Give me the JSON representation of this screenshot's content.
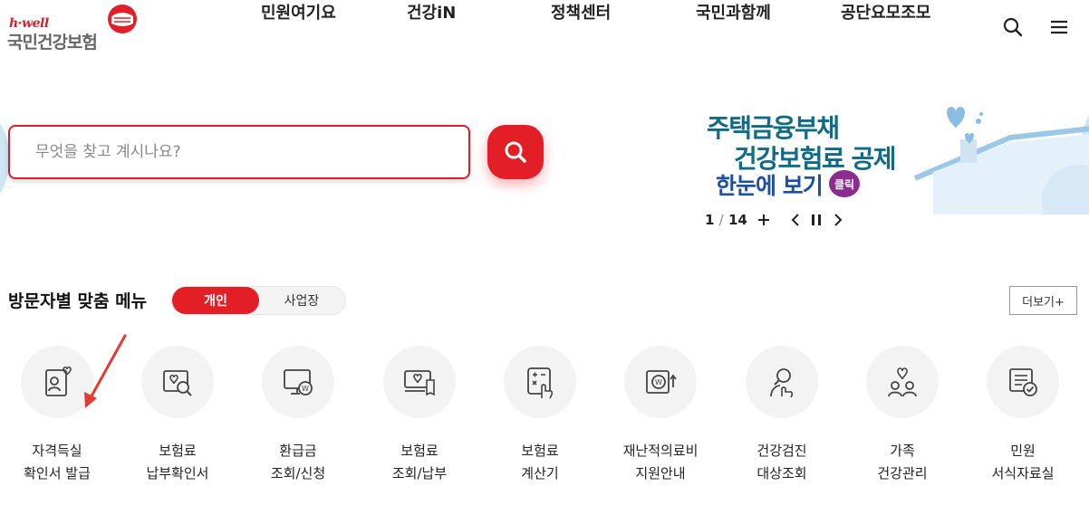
{
  "header": {
    "logo_small": "h·well",
    "logo_name": "국민건강보험",
    "nav": [
      "민원여기요",
      "건강iN",
      "정책센터",
      "국민과함께",
      "공단요모조모"
    ]
  },
  "search": {
    "placeholder": "무엇을 찾고 계시나요?",
    "value": ""
  },
  "banner": {
    "line1": "주택금융부채",
    "line2": "건강보험료 공제",
    "line3": "한눈에 보기",
    "click": "클릭",
    "current": "1",
    "separator": "/",
    "total": "14"
  },
  "section": {
    "title": "방문자별 맞춤 메뉴",
    "toggle_active": "개인",
    "toggle_inactive": "사업장",
    "more": "더보기+"
  },
  "menu": [
    {
      "label": "자격득실\n확인서 발급",
      "icon": "person-card-icon"
    },
    {
      "label": "보험료\n납부확인서",
      "icon": "heart-search-icon"
    },
    {
      "label": "환급금\n조회/신청",
      "icon": "monitor-won-icon"
    },
    {
      "label": "보험료\n조회/납부",
      "icon": "heart-receipt-icon"
    },
    {
      "label": "보험료\n계산기",
      "icon": "calculator-icon"
    },
    {
      "label": "재난적의료비\n지원안내",
      "icon": "won-support-icon"
    },
    {
      "label": "건강검진\n대상조회",
      "icon": "checkup-icon"
    },
    {
      "label": "가족\n건강관리",
      "icon": "family-icon"
    },
    {
      "label": "민원\n서식자료실",
      "icon": "document-check-icon"
    }
  ],
  "colors": {
    "brand_red": "#e41e26",
    "banner_teal": "#0f6b86",
    "banner_blue": "#1f4fa0",
    "banner_click": "#8b2c8f"
  }
}
